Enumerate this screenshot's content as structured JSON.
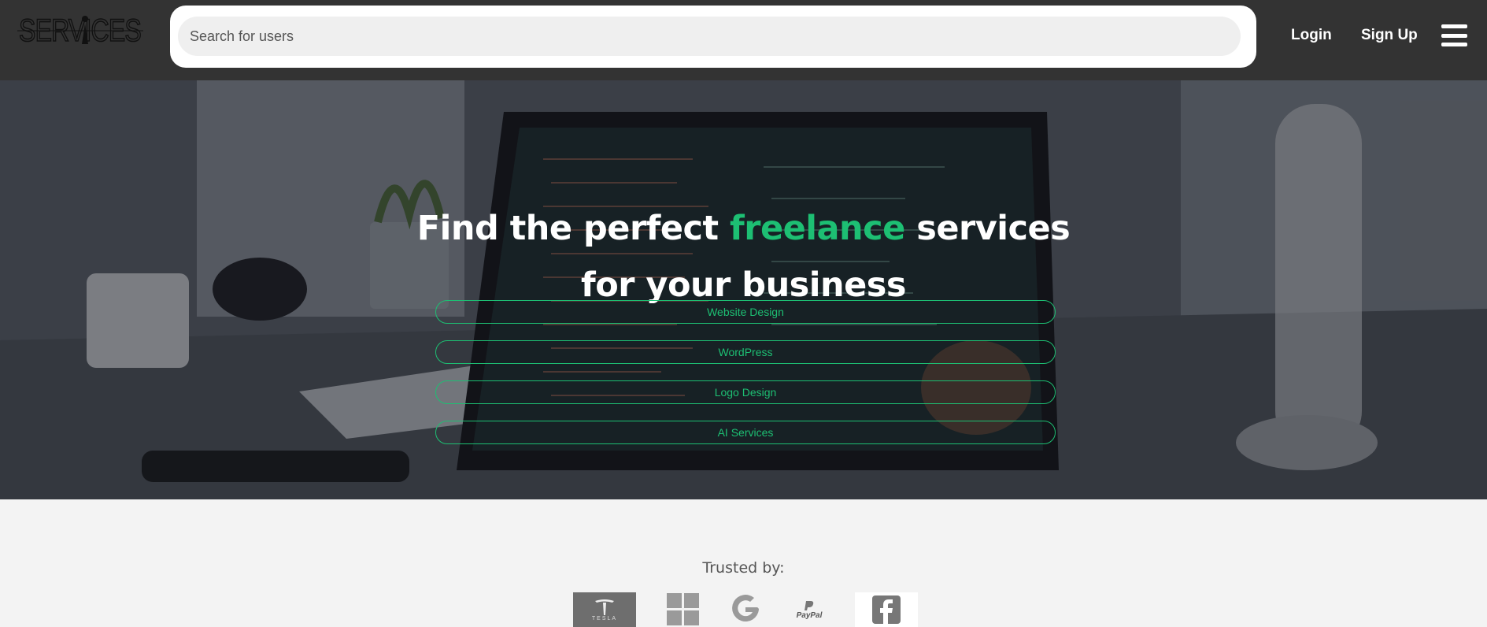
{
  "header": {
    "logo_text": "SERVICES",
    "search": {
      "placeholder": "Search for users",
      "value": ""
    },
    "nav": {
      "login_label": "Login",
      "signup_label": "Sign Up"
    },
    "menu_icon": "hamburger-menu-icon"
  },
  "hero": {
    "title_part1": "Find the perfect ",
    "title_accent": "freelance",
    "title_part2": " services",
    "title_line2": "for your business",
    "categories": [
      {
        "label": "Website Design"
      },
      {
        "label": "WordPress"
      },
      {
        "label": "Logo Design"
      },
      {
        "label": "AI Services"
      }
    ],
    "background_image": "desk-laptop-code-photo"
  },
  "trusted": {
    "label": "Trusted by:",
    "brands": [
      {
        "name": "tesla",
        "text": "TESLA"
      },
      {
        "name": "windows"
      },
      {
        "name": "google"
      },
      {
        "name": "paypal",
        "text": "PayPal"
      },
      {
        "name": "facebook"
      }
    ]
  },
  "colors": {
    "accent": "#1dbf73",
    "header_bg": "#333333",
    "page_bg": "#f3f3f3"
  }
}
